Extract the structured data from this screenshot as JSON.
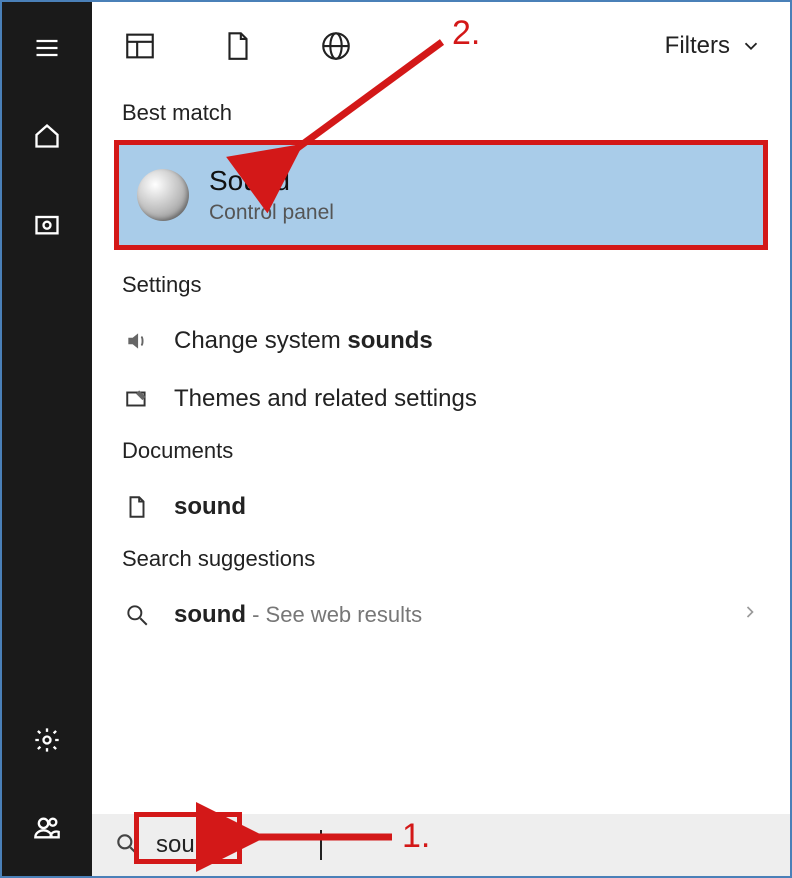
{
  "sidebar": {
    "items": [
      "menu",
      "home",
      "photos",
      "settings",
      "people"
    ]
  },
  "topbar": {
    "apps_icon": "apps",
    "documents_icon": "documents",
    "web_icon": "web",
    "filters_label": "Filters"
  },
  "sections": {
    "best_match_header": "Best match",
    "best_match": {
      "title": "Sound",
      "subtitle": "Control panel"
    },
    "settings_header": "Settings",
    "settings_items": [
      {
        "prefix": "Change system ",
        "bold": "sounds"
      },
      {
        "prefix": "Themes and related settings",
        "bold": ""
      }
    ],
    "documents_header": "Documents",
    "documents_items": [
      {
        "bold": "sound"
      }
    ],
    "suggestions_header": "Search suggestions",
    "suggestions_items": [
      {
        "bold": "sound",
        "postfix": " - See web results"
      }
    ]
  },
  "search": {
    "value": "sound"
  },
  "annotations": {
    "step1": "1.",
    "step2": "2."
  }
}
